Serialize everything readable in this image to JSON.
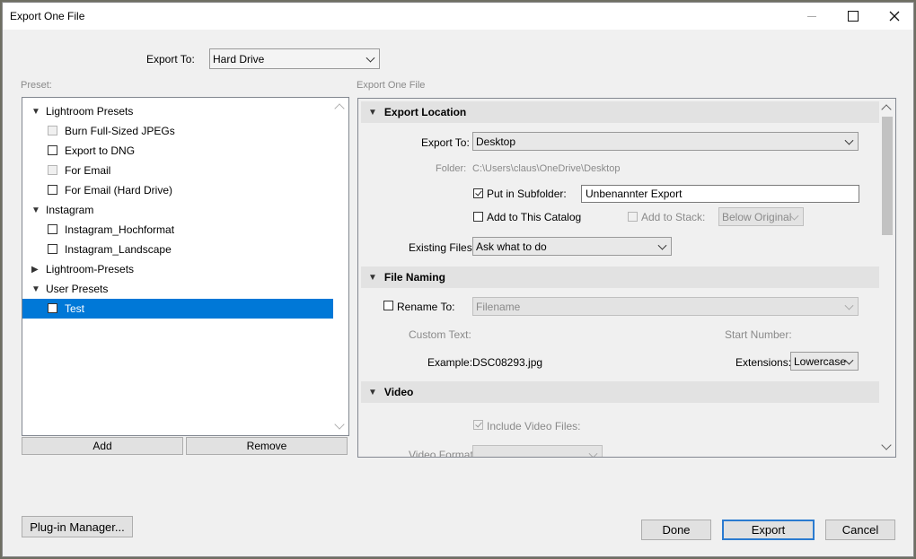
{
  "window": {
    "title": "Export One File"
  },
  "export_to_top": {
    "label": "Export To:",
    "value": "Hard Drive"
  },
  "preset": {
    "heading": "Preset:",
    "items": [
      {
        "label": "Lightroom Presets"
      },
      {
        "label": "Burn Full-Sized JPEGs"
      },
      {
        "label": "Export to DNG"
      },
      {
        "label": "For Email"
      },
      {
        "label": "For Email (Hard Drive)"
      },
      {
        "label": "Instagram"
      },
      {
        "label": "Instagram_Hochformat"
      },
      {
        "label": "Instagram_Landscape"
      },
      {
        "label": "Lightroom-Presets"
      },
      {
        "label": "User Presets"
      },
      {
        "label": "Test"
      }
    ],
    "add_label": "Add",
    "remove_label": "Remove"
  },
  "settings": {
    "heading": "Export One File",
    "export_location": {
      "title": "Export Location",
      "export_to_label": "Export To:",
      "export_to_value": "Desktop",
      "folder_label": "Folder:",
      "folder_value": "C:\\Users\\claus\\OneDrive\\Desktop",
      "subfolder_label": "Put in Subfolder:",
      "subfolder_value": "Unbenannter Export",
      "add_catalog_label": "Add to This Catalog",
      "add_stack_label": "Add to Stack:",
      "stack_value": "Below Original",
      "existing_label": "Existing Files:",
      "existing_value": "Ask what to do"
    },
    "file_naming": {
      "title": "File Naming",
      "rename_label": "Rename To:",
      "rename_value": "Filename",
      "custom_text_label": "Custom Text:",
      "start_number_label": "Start Number:",
      "example_label": "Example:",
      "example_value": "DSC08293.jpg",
      "extensions_label": "Extensions:",
      "extensions_value": "Lowercase"
    },
    "video": {
      "title": "Video",
      "include_label": "Include Video Files:",
      "format_label": "Video Format:"
    }
  },
  "footer": {
    "plugin_label": "Plug-in Manager...",
    "done_label": "Done",
    "export_label": "Export",
    "cancel_label": "Cancel"
  }
}
